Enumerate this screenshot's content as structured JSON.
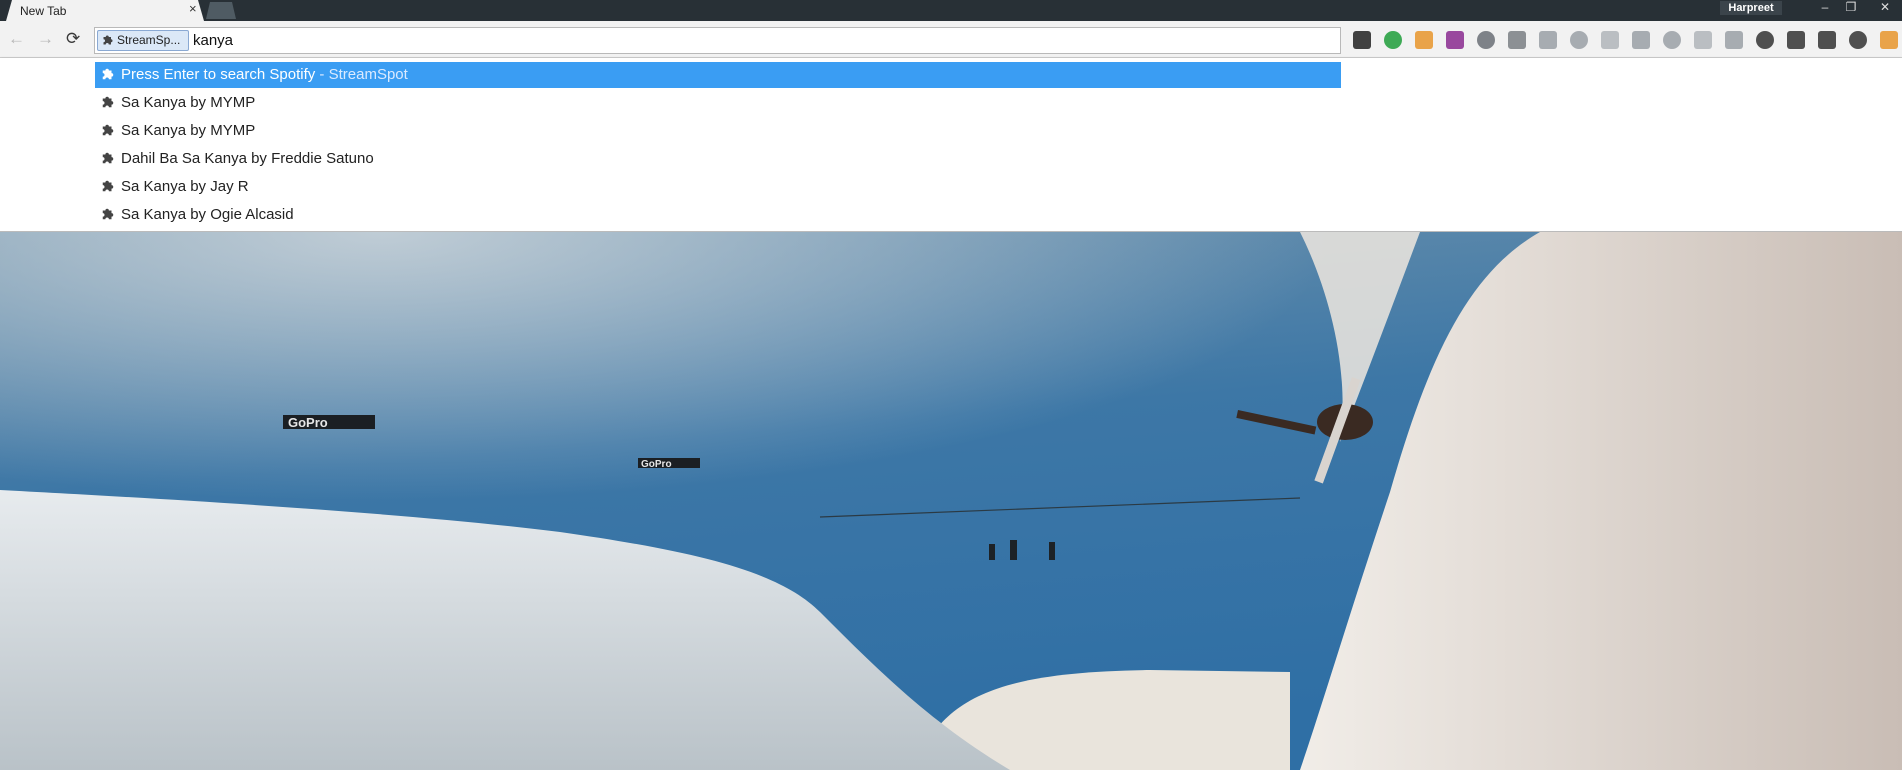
{
  "browser": {
    "tab_title": "New Tab",
    "tab_close": "×",
    "profile_name": "Harpreet",
    "window_controls": {
      "minimize": "–",
      "maximize": "❐",
      "close": "✕"
    }
  },
  "toolbar": {
    "back_icon": "←",
    "forward_icon": "→",
    "reload_icon": "⟳",
    "keyword_chip": "StreamSp...",
    "query": "kanya"
  },
  "extensions": [
    {
      "name": "s-green-arrow-icon",
      "color": "#222"
    },
    {
      "name": "d-green-circle-icon",
      "color": "#1f9d3a"
    },
    {
      "name": "orange-bag-icon",
      "color": "#e8952b"
    },
    {
      "name": "purple-s-icon",
      "color": "#8a2a8f"
    },
    {
      "name": "ublock-shield-icon",
      "color": "#6a6f76"
    },
    {
      "name": "grey-circle-icon",
      "color": "#7a7f84"
    },
    {
      "name": "css-icon",
      "color": "#9aa0a6"
    },
    {
      "name": "drive-icon",
      "color": "#9aa0a6"
    },
    {
      "name": "cloud-sync-icon",
      "color": "#b0b5ba"
    },
    {
      "name": "magnifier-icon",
      "color": "#9aa0a6"
    },
    {
      "name": "k-box-icon",
      "color": "#9aa0a6"
    },
    {
      "name": "m-circle-icon",
      "color": "#b0b5ba"
    },
    {
      "name": "database-icon",
      "color": "#9aa0a6"
    },
    {
      "name": "pocket-icon",
      "color": "#333"
    },
    {
      "name": "cast-icon",
      "color": "#333"
    },
    {
      "name": "wheel-icon",
      "color": "#333"
    },
    {
      "name": "s-box-icon",
      "color": "#333"
    },
    {
      "name": "ext-overflow-icon",
      "color": "#e8952b"
    }
  ],
  "dropdown": {
    "suggestions": [
      {
        "text": "Press Enter to search Spotify",
        "desc": " - StreamSpot",
        "selected": true
      },
      {
        "text": "Sa Kanya by MYMP",
        "desc": "",
        "selected": false
      },
      {
        "text": "Sa Kanya by MYMP",
        "desc": "",
        "selected": false
      },
      {
        "text": "Dahil Ba Sa Kanya by Freddie Satuno",
        "desc": "",
        "selected": false
      },
      {
        "text": "Sa Kanya by Jay R",
        "desc": "",
        "selected": false
      },
      {
        "text": "Sa Kanya by Ogie Alcasid",
        "desc": "",
        "selected": false
      }
    ]
  },
  "photo": {
    "banner_text_1": "GoPro",
    "banner_text_2": "GoPro"
  }
}
